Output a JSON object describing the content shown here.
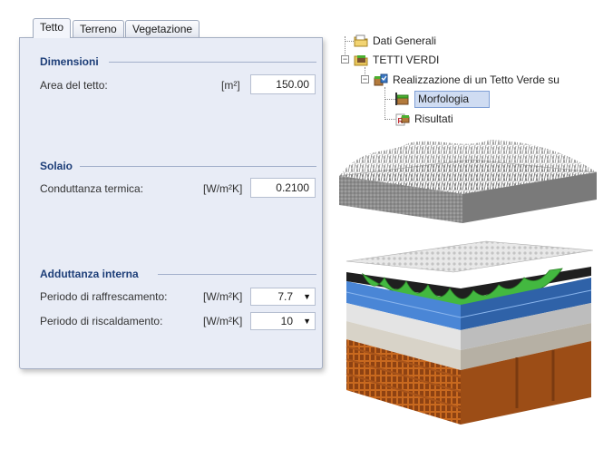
{
  "tabs": [
    {
      "label": "Tetto",
      "active": true
    },
    {
      "label": "Terreno",
      "active": false
    },
    {
      "label": "Vegetazione",
      "active": false
    }
  ],
  "sections": {
    "dimensioni": {
      "title": "Dimensioni",
      "area_label": "Area del tetto:",
      "area_unit": "[m²]",
      "area_value": "150.00"
    },
    "solaio": {
      "title": "Solaio",
      "cond_label": "Conduttanza termica:",
      "cond_unit": "[W/m²K]",
      "cond_value": "0.2100"
    },
    "adduttanza": {
      "title": "Adduttanza interna",
      "raff_label": "Periodo di raffrescamento:",
      "raff_unit": "[W/m²K]",
      "raff_value": "7.7",
      "risc_label": "Periodo di riscaldamento:",
      "risc_unit": "[W/m²K]",
      "risc_value": "10"
    }
  },
  "tree": {
    "items": [
      {
        "label": "Dati Generali",
        "icon": "folder-icon"
      },
      {
        "label": "TETTI VERDI",
        "icon": "green-roof-folder-icon",
        "expanded": true
      },
      {
        "label": "Realizzazione di un Tetto Verde su",
        "icon": "project-icon",
        "expanded": true
      },
      {
        "label": "Morfologia",
        "icon": "morphology-icon",
        "selected": true
      },
      {
        "label": "Risultati",
        "icon": "results-icon"
      }
    ]
  },
  "colors": {
    "panel_bg": "#e8ecf6",
    "section_title": "#1d3e78",
    "selection": "#cfdcf2"
  }
}
